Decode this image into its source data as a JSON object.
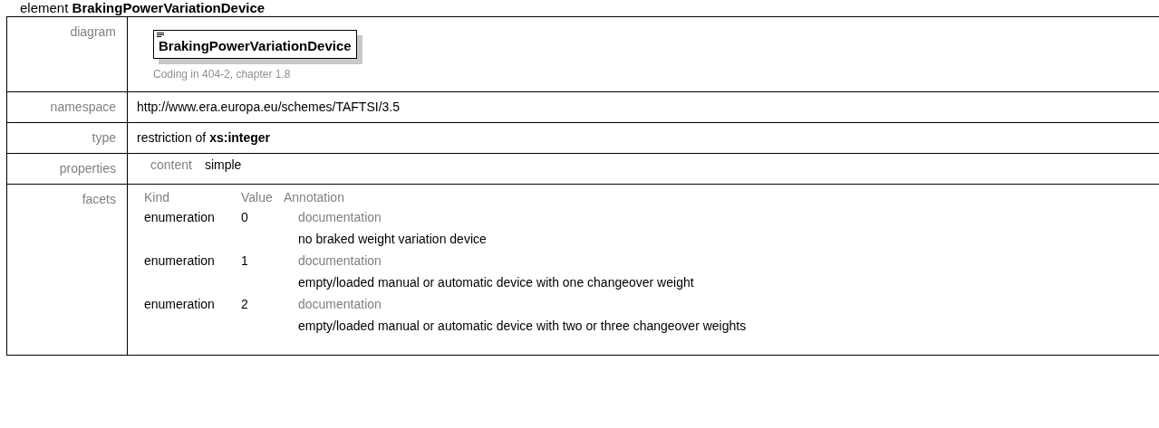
{
  "heading": {
    "prefix": "element",
    "name": "BrakingPowerVariationDevice"
  },
  "rows": [
    {
      "kind": "diagram",
      "label": "diagram",
      "element_name": "BrakingPowerVariationDevice",
      "annotation": "Coding in 404-2, chapter 1.8"
    },
    {
      "kind": "text",
      "label": "namespace",
      "value": "http://www.era.europa.eu/schemes/TAFTSI/3.5"
    },
    {
      "kind": "rich",
      "label": "type",
      "value": "restriction of **xs:integer**"
    },
    {
      "kind": "properties",
      "label": "properties",
      "items": [
        {
          "name": "content",
          "value": "simple"
        }
      ]
    },
    {
      "kind": "facets",
      "label": "facets",
      "columns": [
        "Kind",
        "Value",
        "Annotation"
      ],
      "items": [
        {
          "kind": "enumeration",
          "value": "0",
          "annotation_label": "documentation",
          "annotation": "no braked weight variation device"
        },
        {
          "kind": "enumeration",
          "value": "1",
          "annotation_label": "documentation",
          "annotation": "empty/loaded manual or automatic device with one changeover weight"
        },
        {
          "kind": "enumeration",
          "value": "2",
          "annotation_label": "documentation",
          "annotation": "empty/loaded manual or automatic device with two or three changeover weights"
        }
      ]
    }
  ]
}
